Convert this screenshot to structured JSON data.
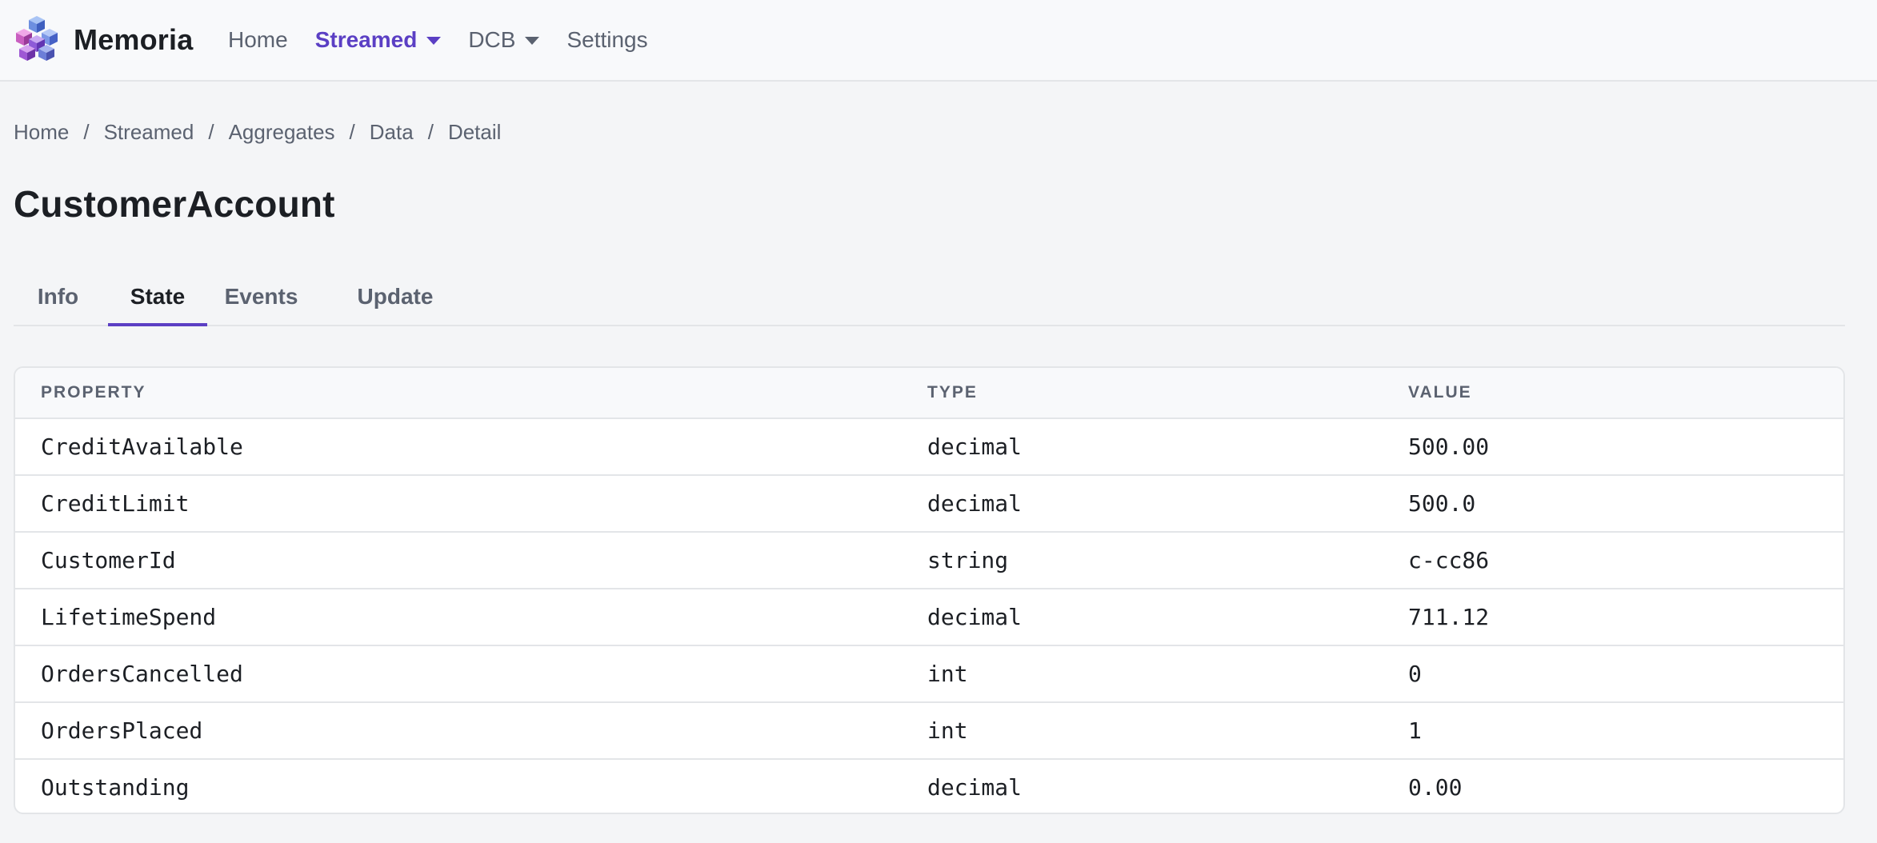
{
  "app": {
    "name": "Memoria",
    "logo_icon": "cubes-logo-icon"
  },
  "nav": {
    "items": [
      {
        "label": "Home",
        "active": false,
        "dropdown": false
      },
      {
        "label": "Streamed",
        "active": true,
        "dropdown": true
      },
      {
        "label": "DCB",
        "active": false,
        "dropdown": true
      },
      {
        "label": "Settings",
        "active": false,
        "dropdown": false
      }
    ]
  },
  "breadcrumb": [
    "Home",
    "Streamed",
    "Aggregates",
    "Data",
    "Detail"
  ],
  "breadcrumb_separator": "/",
  "page": {
    "title": "CustomerAccount"
  },
  "tabs": [
    {
      "label": "Info",
      "active": false
    },
    {
      "label": "State",
      "active": true
    },
    {
      "label": "Events",
      "active": false
    },
    {
      "label": "Update",
      "active": false
    }
  ],
  "table": {
    "headers": [
      "PROPERTY",
      "TYPE",
      "VALUE"
    ],
    "rows": [
      [
        "CreditAvailable",
        "decimal",
        "500.00"
      ],
      [
        "CreditLimit",
        "decimal",
        "500.0"
      ],
      [
        "CustomerId",
        "string",
        "c-cc86"
      ],
      [
        "LifetimeSpend",
        "decimal",
        "711.12"
      ],
      [
        "OrdersCancelled",
        "int",
        "0"
      ],
      [
        "OrdersPlaced",
        "int",
        "1"
      ],
      [
        "Outstanding",
        "decimal",
        "0.00"
      ]
    ]
  },
  "colors": {
    "accent": "#5b3fc4",
    "background": "#f4f5f7",
    "border": "#e3e5e8",
    "muted_text": "#5b6270"
  }
}
